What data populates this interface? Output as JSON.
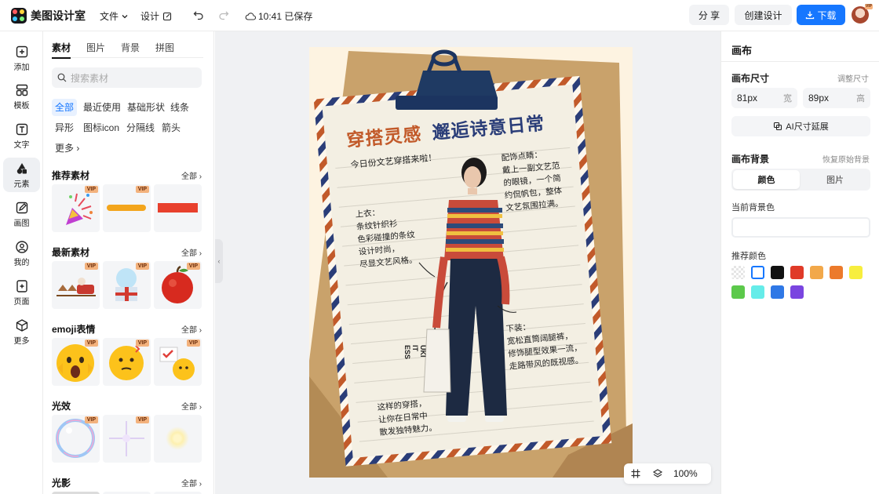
{
  "app": {
    "name": "美图设计室"
  },
  "topbar": {
    "file_menu": "文件",
    "design_menu": "设计",
    "save_status": "10:41 已保存",
    "share_label": "分 享",
    "create_design_label": "创建设计",
    "download_label": "下载",
    "avatar_badge": "VIP"
  },
  "leftnav": {
    "items": [
      {
        "label": "添加",
        "icon": "plus-square-icon"
      },
      {
        "label": "模板",
        "icon": "template-icon"
      },
      {
        "label": "文字",
        "icon": "text-icon"
      },
      {
        "label": "元素",
        "icon": "shapes-icon"
      },
      {
        "label": "画图",
        "icon": "draw-icon"
      },
      {
        "label": "我的",
        "icon": "user-icon"
      },
      {
        "label": "页面",
        "icon": "page-add-icon"
      },
      {
        "label": "更多",
        "icon": "cube-icon"
      }
    ],
    "active": "元素"
  },
  "panel": {
    "tabs": [
      "素材",
      "图片",
      "背景",
      "拼图"
    ],
    "active_tab": "素材",
    "search_placeholder": "搜索素材",
    "chips": [
      "全部",
      "最近使用",
      "基础形状",
      "线条",
      "异形",
      "图标icon",
      "分隔线",
      "箭头",
      "更多"
    ],
    "active_chip": "全部",
    "vip_label": "VIP",
    "sections": [
      {
        "title": "推荐素材",
        "all": "全部"
      },
      {
        "title": "最新素材",
        "all": "全部"
      },
      {
        "title": "emoji表情",
        "all": "全部"
      },
      {
        "title": "光效",
        "all": "全部"
      },
      {
        "title": "光影",
        "all": "全部"
      }
    ]
  },
  "poster": {
    "title_part1": "穿搭灵感",
    "title_part2": "邂逅诗意日常",
    "intro": "今日份文艺穿搭来啦！",
    "accessory_lines": [
      "配饰点睛：",
      "戴上一副文艺范",
      "的眼镜，一个简",
      "约侃帆包，整体",
      "文艺氛围拉满。"
    ],
    "top_lines": [
      "上衣：",
      "条纹针织衫",
      "色彩碰撞的条纹",
      "设计时尚，",
      "尽显文艺风格。"
    ],
    "bottom_lines": [
      "下装：",
      "宽松直筒阔腿裤，",
      "修饰腿型效果一流，",
      "走路带风的既视感。"
    ],
    "closing_lines": [
      "这样的穿搭，",
      "让你在日常中",
      "散发独特魅力。"
    ],
    "bag_text": [
      "UKI",
      "IT",
      "ESS"
    ]
  },
  "zoom": {
    "level": "100%"
  },
  "rightpanel": {
    "title": "画布",
    "size_label": "画布尺寸",
    "adjust_size": "调整尺寸",
    "width_value": "81px",
    "width_unit": "宽",
    "height_value": "89px",
    "height_unit": "高",
    "ai_extend": "AI尺寸延展",
    "bg_label": "画布背景",
    "restore_bg": "恢复原始背景",
    "bg_tabs": [
      "颜色",
      "图片"
    ],
    "current_bg_label": "当前背景色",
    "current_bg_value": "",
    "recommended_label": "推荐颜色",
    "swatches": [
      "transparent",
      "#ffffff",
      "#111111",
      "#e03a28",
      "#f2a84a",
      "#ec7a2b",
      "#f7ee3e",
      "#5cc94b",
      "#66ece9",
      "#2f78e6",
      "#7a45e0"
    ]
  },
  "colors": {
    "accent": "#1677ff",
    "stamp_blue": "#2a3d78",
    "stamp_red": "#c25a2a"
  }
}
